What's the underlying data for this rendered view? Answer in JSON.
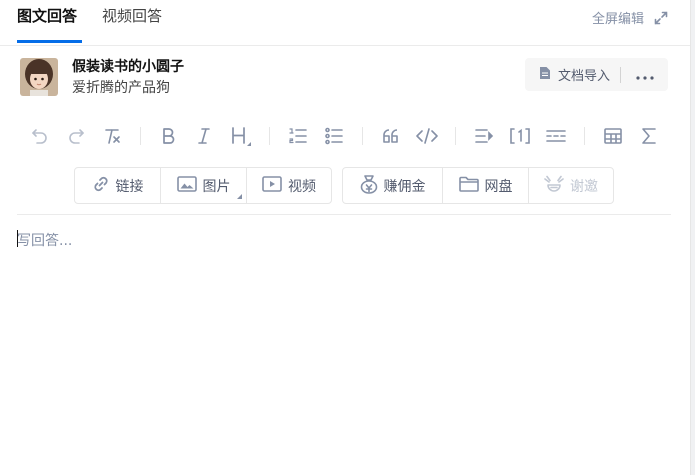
{
  "tabs": [
    {
      "label": "图文回答",
      "active": true
    },
    {
      "label": "视频回答",
      "active": false
    }
  ],
  "fullscreen": {
    "label": "全屏编辑",
    "icon": "expand-icon"
  },
  "author": {
    "name": "假装读书的小圆子",
    "bio": "爱折腾的产品狗",
    "avatar_icon": "avatar-photo"
  },
  "doc_import": {
    "label": "文档导入",
    "icon": "document-icon",
    "more_icon": "more-dots-icon"
  },
  "format_toolbar": [
    {
      "icon": "undo-icon",
      "enabled": false
    },
    {
      "icon": "redo-icon",
      "enabled": false
    },
    {
      "icon": "clear-format-icon",
      "enabled": true
    },
    {
      "icon": "bold-icon",
      "enabled": true
    },
    {
      "icon": "italic-icon",
      "enabled": true
    },
    {
      "icon": "heading-icon",
      "enabled": true
    },
    {
      "icon": "ordered-list-icon",
      "enabled": true
    },
    {
      "icon": "bullet-list-icon",
      "enabled": true
    },
    {
      "icon": "quote-icon",
      "enabled": true
    },
    {
      "icon": "code-icon",
      "enabled": true
    },
    {
      "icon": "line-spacing-icon",
      "enabled": true
    },
    {
      "icon": "footnote-icon",
      "enabled": true
    },
    {
      "icon": "divider-line-icon",
      "enabled": true
    },
    {
      "icon": "table-icon",
      "enabled": true
    },
    {
      "icon": "formula-icon",
      "enabled": true
    }
  ],
  "insert_toolbar": {
    "group1": [
      {
        "label": "链接",
        "icon": "link-icon"
      },
      {
        "label": "图片",
        "icon": "image-icon"
      },
      {
        "label": "视频",
        "icon": "video-icon"
      }
    ],
    "group2": [
      {
        "label": "赚佣金",
        "icon": "commission-icon",
        "enabled": true
      },
      {
        "label": "网盘",
        "icon": "folder-icon",
        "enabled": true
      },
      {
        "label": "谢邀",
        "icon": "invite-icon",
        "enabled": false
      }
    ]
  },
  "editor": {
    "placeholder": "写回答..."
  },
  "colors": {
    "accent": "#056de8",
    "icon": "#8590a6",
    "text": "#121212",
    "muted": "#8590a6"
  }
}
